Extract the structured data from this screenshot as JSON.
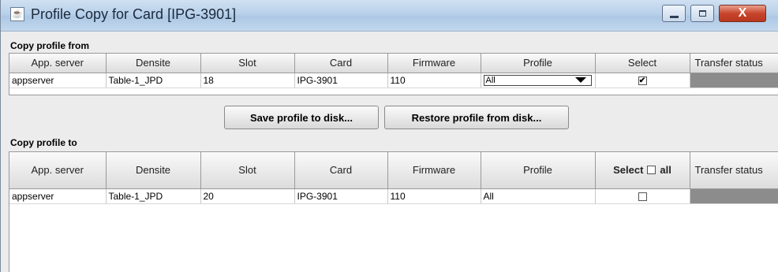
{
  "window": {
    "title": "Profile Copy for Card [IPG-3901]",
    "close_glyph": "X"
  },
  "from": {
    "label": "Copy profile from",
    "columns": [
      "App. server",
      "Densite",
      "Slot",
      "Card",
      "Firmware",
      "Profile",
      "Select",
      "Transfer status"
    ],
    "row": {
      "app_server": "appserver",
      "densite": "Table-1_JPD",
      "slot": "18",
      "card": "IPG-3901",
      "firmware": "110",
      "profile": "All",
      "select_checked": true,
      "check_glyph": "✔"
    }
  },
  "buttons": {
    "save": "Save profile to disk...",
    "restore": "Restore profile from disk..."
  },
  "to": {
    "label": "Copy profile to",
    "columns": [
      "App. server",
      "Densite",
      "Slot",
      "Card",
      "Firmware",
      "Profile",
      "Select",
      "all",
      "Transfer status"
    ],
    "row": {
      "app_server": "appserver",
      "densite": "Table-1_JPD",
      "slot": "20",
      "card": "IPG-3901",
      "firmware": "110",
      "profile": "All",
      "select_checked": false
    }
  },
  "colors": {
    "status_fill": "#8c8c8c",
    "title_bg": "#b9d1ea",
    "close_red": "#c8452c"
  }
}
